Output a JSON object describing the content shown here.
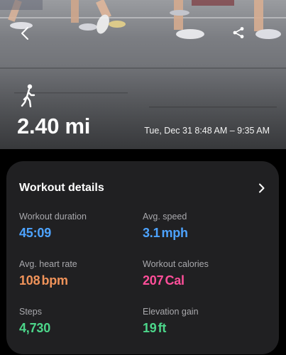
{
  "workout": {
    "distance": "2.40 mi",
    "datetime": "Tue, Dec 31 8:48 AM – 9:35 AM"
  },
  "details": {
    "title": "Workout details",
    "metrics": [
      {
        "label": "Workout duration",
        "value": "45:09",
        "unit": "",
        "color": "#4da3ff"
      },
      {
        "label": "Avg. speed",
        "value": "3.1",
        "unit": "mph",
        "color": "#4da3ff"
      },
      {
        "label": "Avg. heart rate",
        "value": "108",
        "unit": "bpm",
        "color": "#f0935a"
      },
      {
        "label": "Workout calories",
        "value": "207",
        "unit": "Cal",
        "color": "#ff4f9a"
      },
      {
        "label": "Steps",
        "value": "4,730",
        "unit": "",
        "color": "#4cd68a"
      },
      {
        "label": "Elevation gain",
        "value": "19",
        "unit": "ft",
        "color": "#4cd68a"
      }
    ]
  },
  "icons": {
    "back": "chevron-left-icon",
    "share": "share-icon",
    "activity": "walking-icon",
    "details": "chevron-right-icon"
  }
}
